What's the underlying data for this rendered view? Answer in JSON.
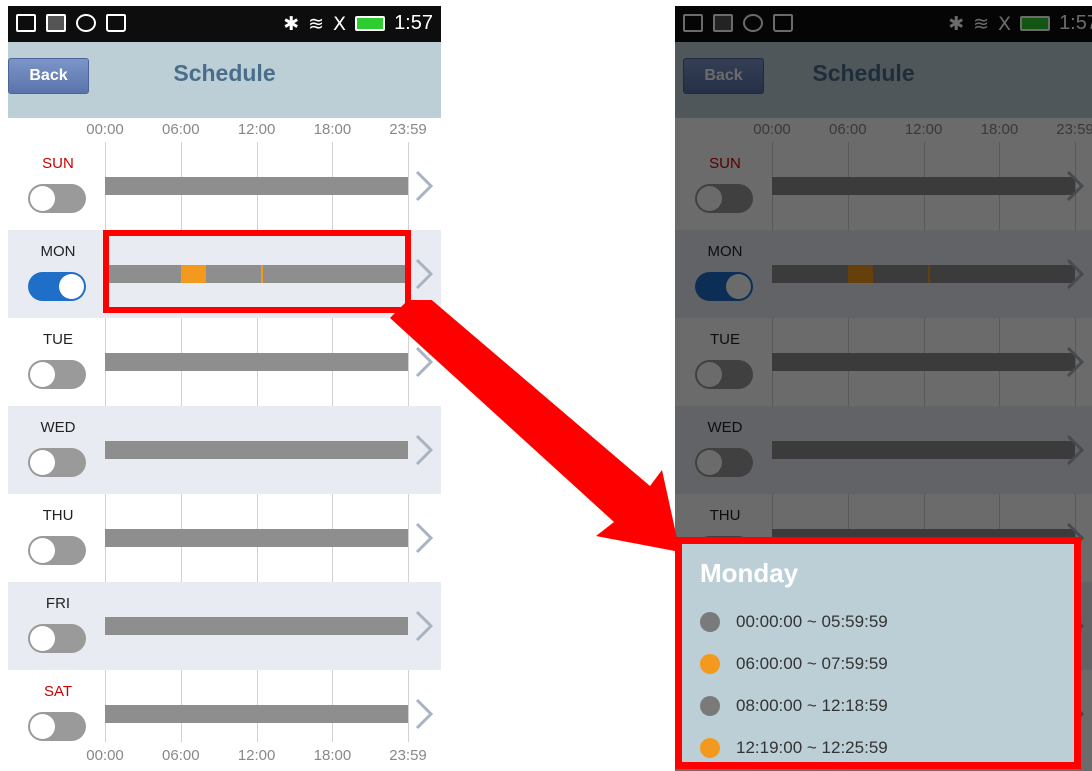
{
  "statusbar": {
    "time": "1:57",
    "bluetooth": "✱",
    "wifi": "≋",
    "signal": "X"
  },
  "app": {
    "title": "Schedule",
    "back_label": "Back"
  },
  "timeline": {
    "ticks": [
      "00:00",
      "06:00",
      "12:00",
      "18:00",
      "23:59"
    ]
  },
  "days": [
    {
      "label": "SUN",
      "weekend": true,
      "enabled": false,
      "segments": []
    },
    {
      "label": "MON",
      "weekend": false,
      "enabled": true,
      "segments": [
        {
          "start": "06:00",
          "end": "07:59"
        },
        {
          "start": "12:19",
          "end": "12:25"
        }
      ]
    },
    {
      "label": "TUE",
      "weekend": false,
      "enabled": false,
      "segments": []
    },
    {
      "label": "WED",
      "weekend": false,
      "enabled": false,
      "segments": []
    },
    {
      "label": "THU",
      "weekend": false,
      "enabled": false,
      "segments": []
    },
    {
      "label": "FRI",
      "weekend": false,
      "enabled": false,
      "segments": []
    },
    {
      "label": "SAT",
      "weekend": true,
      "enabled": false,
      "segments": []
    }
  ],
  "popup": {
    "title": "Monday",
    "slots": [
      {
        "range": "00:00:00 ~ 05:59:59",
        "active": false
      },
      {
        "range": "06:00:00 ~ 07:59:59",
        "active": true
      },
      {
        "range": "08:00:00 ~ 12:18:59",
        "active": false
      },
      {
        "range": "12:19:00 ~ 12:25:59",
        "active": true
      }
    ]
  },
  "colors": {
    "active": "#f39a1e",
    "inactive": "#8e8e8e",
    "highlight": "#ff0000",
    "toggle_on": "#1f6fc8",
    "weekend": "#cc0000"
  }
}
